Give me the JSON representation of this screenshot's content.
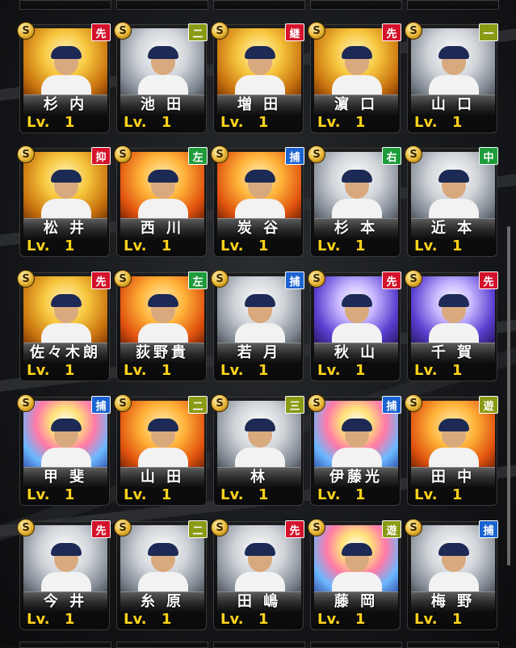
{
  "cards": [
    {
      "name": "杉 内",
      "level": "Lv. 1",
      "position": "先",
      "pos_color": "red",
      "rarity": "S",
      "bg": "gold"
    },
    {
      "name": "池 田",
      "level": "Lv. 1",
      "position": "二",
      "pos_color": "olive",
      "rarity": "S",
      "bg": "gray"
    },
    {
      "name": "増 田",
      "level": "Lv. 1",
      "position": "継",
      "pos_color": "red",
      "rarity": "S",
      "bg": "gold"
    },
    {
      "name": "濵 口",
      "level": "Lv. 1",
      "position": "先",
      "pos_color": "red",
      "rarity": "S",
      "bg": "gold"
    },
    {
      "name": "山 口",
      "level": "Lv. 1",
      "position": "一",
      "pos_color": "olive",
      "rarity": "S",
      "bg": "gray"
    },
    {
      "name": "松 井",
      "level": "Lv. 1",
      "position": "抑",
      "pos_color": "red",
      "rarity": "S",
      "bg": "gold"
    },
    {
      "name": "西 川",
      "level": "Lv. 1",
      "position": "左",
      "pos_color": "green",
      "rarity": "S",
      "bg": "orange"
    },
    {
      "name": "炭 谷",
      "level": "Lv. 1",
      "position": "捕",
      "pos_color": "blue",
      "rarity": "S",
      "bg": "orange"
    },
    {
      "name": "杉 本",
      "level": "Lv. 1",
      "position": "右",
      "pos_color": "green",
      "rarity": "S",
      "bg": "gray"
    },
    {
      "name": "近 本",
      "level": "Lv. 1",
      "position": "中",
      "pos_color": "green",
      "rarity": "S",
      "bg": "gray"
    },
    {
      "name": "佐々木朗",
      "level": "Lv. 1",
      "position": "先",
      "pos_color": "red",
      "rarity": "S",
      "bg": "gold"
    },
    {
      "name": "荻野貴",
      "level": "Lv. 1",
      "position": "左",
      "pos_color": "green",
      "rarity": "S",
      "bg": "orange"
    },
    {
      "name": "若 月",
      "level": "Lv. 1",
      "position": "捕",
      "pos_color": "blue",
      "rarity": "S",
      "bg": "gray"
    },
    {
      "name": "秋 山",
      "level": "Lv. 1",
      "position": "先",
      "pos_color": "red",
      "rarity": "S",
      "bg": "purple"
    },
    {
      "name": "千 賀",
      "level": "Lv. 1",
      "position": "先",
      "pos_color": "red",
      "rarity": "S",
      "bg": "purple"
    },
    {
      "name": "甲 斐",
      "level": "Lv. 1",
      "position": "捕",
      "pos_color": "blue",
      "rarity": "S",
      "bg": "rainbow"
    },
    {
      "name": "山 田",
      "level": "Lv. 1",
      "position": "二",
      "pos_color": "olive",
      "rarity": "S",
      "bg": "orange"
    },
    {
      "name": "林",
      "level": "Lv. 1",
      "position": "三",
      "pos_color": "olive",
      "rarity": "S",
      "bg": "gray"
    },
    {
      "name": "伊藤光",
      "level": "Lv. 1",
      "position": "捕",
      "pos_color": "blue",
      "rarity": "S",
      "bg": "rainbow"
    },
    {
      "name": "田 中",
      "level": "Lv. 1",
      "position": "遊",
      "pos_color": "olive",
      "rarity": "S",
      "bg": "orange"
    },
    {
      "name": "今 井",
      "level": "Lv. 1",
      "position": "先",
      "pos_color": "red",
      "rarity": "S",
      "bg": "gray"
    },
    {
      "name": "糸 原",
      "level": "Lv. 1",
      "position": "二",
      "pos_color": "olive",
      "rarity": "S",
      "bg": "gray"
    },
    {
      "name": "田 嶋",
      "level": "Lv. 1",
      "position": "先",
      "pos_color": "red",
      "rarity": "S",
      "bg": "gray"
    },
    {
      "name": "藤 岡",
      "level": "Lv. 1",
      "position": "遊",
      "pos_color": "olive",
      "rarity": "S",
      "bg": "rainbow"
    },
    {
      "name": "梅 野",
      "level": "Lv. 1",
      "position": "捕",
      "pos_color": "blue",
      "rarity": "S",
      "bg": "gray"
    }
  ]
}
